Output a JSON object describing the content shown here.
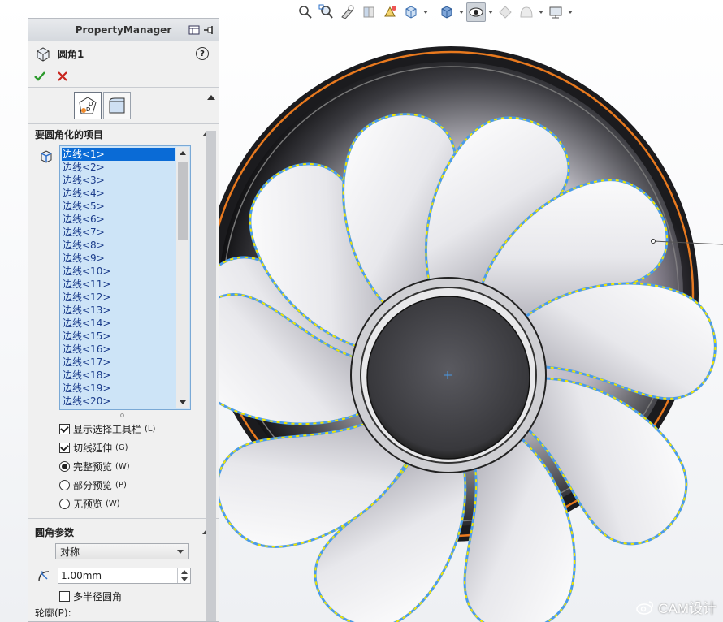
{
  "property_manager": {
    "header_title": "PropertyManager",
    "feature_title": "圆角1",
    "help_label": "?",
    "items_section": {
      "title": "要圆角化的项目",
      "edges": [
        "边线<1>",
        "边线<2>",
        "边线<3>",
        "边线<4>",
        "边线<5>",
        "边线<6>",
        "边线<7>",
        "边线<8>",
        "边线<9>",
        "边线<10>",
        "边线<11>",
        "边线<12>",
        "边线<13>",
        "边线<14>",
        "边线<15>",
        "边线<16>",
        "边线<17>",
        "边线<18>",
        "边线<19>",
        "边线<20>"
      ],
      "selected_index": 0
    },
    "options": {
      "show_toolbar": {
        "label": "显示选择工具栏",
        "shortcut": "(L)",
        "checked": true
      },
      "tangent_propagation": {
        "label": "切线延伸",
        "shortcut": "(G)",
        "checked": true
      },
      "full_preview": {
        "label": "完整预览",
        "shortcut": "(W)",
        "checked": true
      },
      "partial_preview": {
        "label": "部分预览",
        "shortcut": "(P)",
        "checked": false
      },
      "no_preview": {
        "label": "无预览",
        "shortcut": "(W)",
        "checked": false
      }
    },
    "fillet_params": {
      "title": "圆角参数",
      "type_value": "对称",
      "radius_value": "1.00mm",
      "multi_radius": {
        "label": "多半径圆角",
        "checked": false
      },
      "profile_label": "轮廓(P):"
    }
  },
  "view_toolbar": {
    "icons": [
      "zoom-to-fit-icon",
      "zoom-area-icon",
      "previous-view-icon",
      "section-view-icon",
      "dynamic-annotation-icon",
      "view-orientation-icon",
      "display-style-icon",
      "hide-show-icon",
      "edit-appearance-icon",
      "apply-scene-icon",
      "view-settings-icon"
    ]
  },
  "watermark": {
    "text": "CAM设计"
  },
  "colors": {
    "selection": "#0a6bd6",
    "list_bg": "#cde4f7",
    "edge_blue": "#4a9be8",
    "edge_yellow": "#f2e600",
    "rim_orange": "#e8791e"
  }
}
